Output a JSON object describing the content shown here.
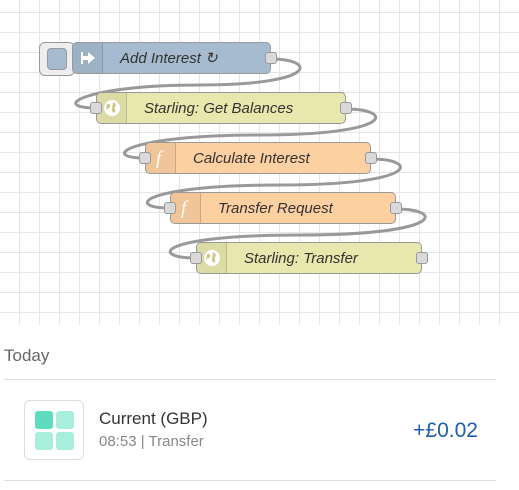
{
  "flow": {
    "nodes": [
      {
        "label": "Add Interest ↻",
        "type": "inject",
        "icon": "arrow-right-icon"
      },
      {
        "label": "Starling: Get Balances",
        "type": "http-request",
        "icon": "globe-icon"
      },
      {
        "label": "Calculate Interest",
        "type": "function",
        "icon": "function-icon"
      },
      {
        "label": "Transfer Request",
        "type": "function",
        "icon": "function-icon"
      },
      {
        "label": "Starling: Transfer",
        "type": "http-request",
        "icon": "globe-icon"
      }
    ],
    "colors": {
      "inject": "#a6bbcf",
      "http-request": "#e7e7ae",
      "function": "#fdd0a2",
      "wire": "#999999"
    }
  },
  "feed": {
    "section_title": "Today",
    "transactions": [
      {
        "name": "Current (GBP)",
        "time": "08:53",
        "type": "Transfer",
        "amount": "+£0.02",
        "amount_color": "#1f5fa6",
        "icon": "account-tiles-icon"
      }
    ]
  }
}
